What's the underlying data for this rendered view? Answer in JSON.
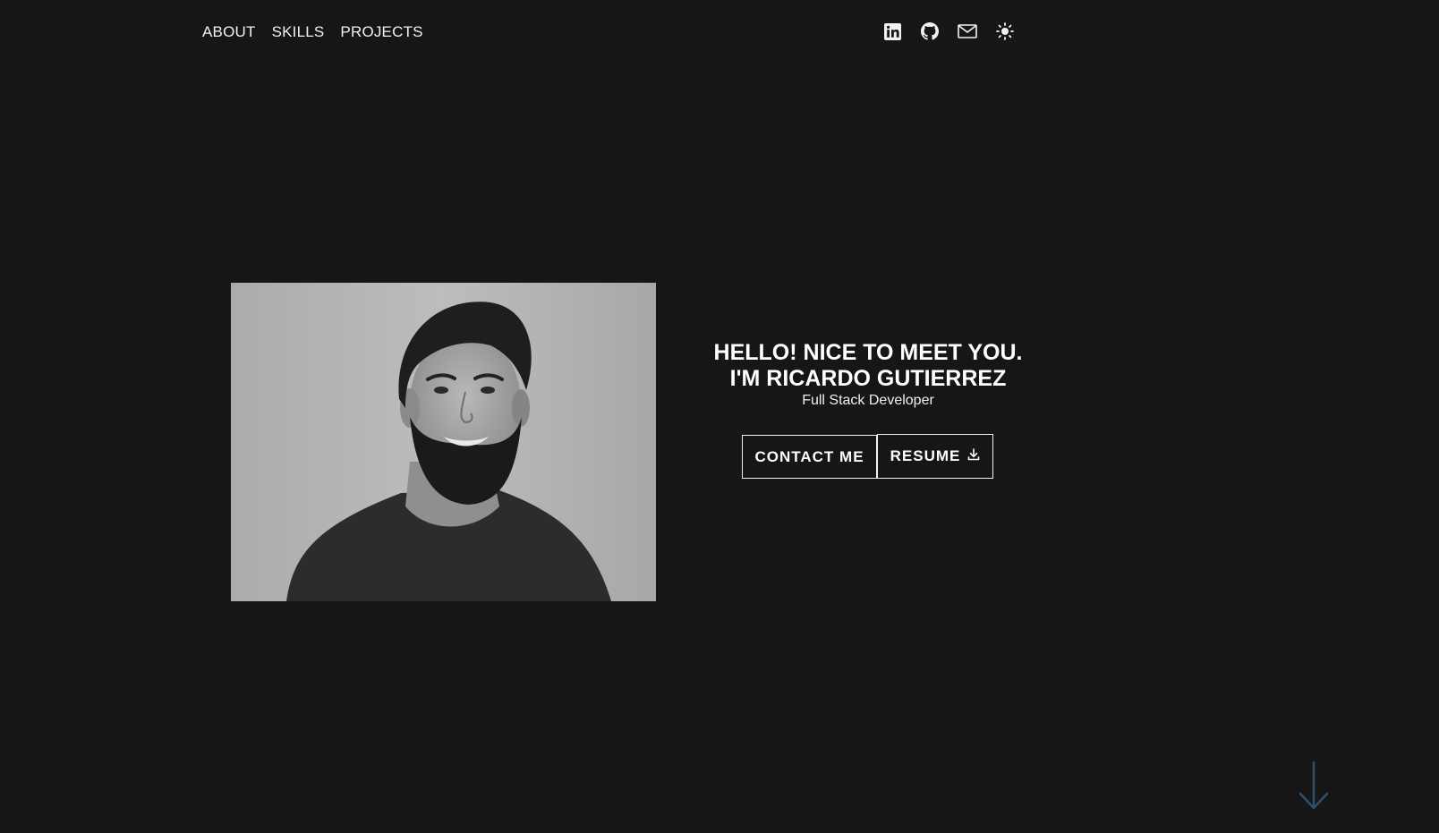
{
  "nav": {
    "items": [
      {
        "label": "ABOUT"
      },
      {
        "label": "SKILLS"
      },
      {
        "label": "PROJECTS"
      }
    ]
  },
  "social": {
    "icons": [
      "linkedin-icon",
      "github-icon",
      "mail-icon",
      "sun-icon"
    ]
  },
  "hero": {
    "greeting_line1": "HELLO! NICE TO MEET YOU.",
    "greeting_line2": "I'M RICARDO GUTIERREZ",
    "role": "Full Stack Developer",
    "contact_label": "CONTACT ME",
    "resume_label": "RESUME",
    "photo_alt": "Ricardo Gutierrez"
  },
  "colors": {
    "background": "#161616",
    "text": "#f2f2f2",
    "scroll_arrow": "#2f4f6e"
  }
}
